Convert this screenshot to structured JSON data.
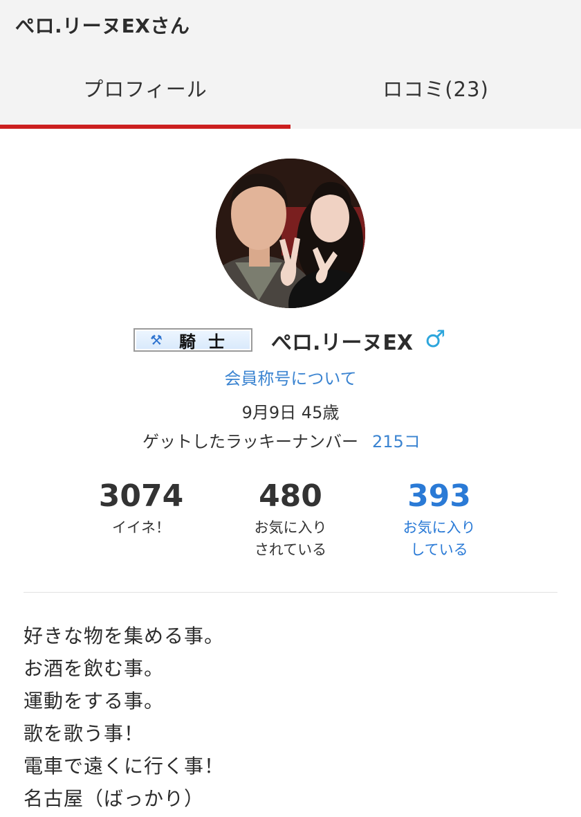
{
  "header": {
    "title": "ぺロ.リーヌEXさん"
  },
  "tabs": [
    {
      "label": "プロフィール",
      "active": true
    },
    {
      "label": "ロコミ(23)",
      "active": false
    }
  ],
  "colors": {
    "accent_red": "#cc1f1f",
    "link_blue": "#3b84d1",
    "stat_blue": "#2a7ad6",
    "gender_blue": "#2da6dc"
  },
  "profile": {
    "avatar_icon": "avatar-photo",
    "rank_badge": {
      "icon": "crossed-axes-icon",
      "icon_glyph": "⚒",
      "text": "騎士"
    },
    "username": "ぺロ.リーヌEX",
    "gender_symbol": "♂",
    "member_title_link": "会員称号について",
    "birthday_age": "9月9日 45歳",
    "lucky_label": "ゲットしたラッキーナンバー",
    "lucky_count": "215コ"
  },
  "stats": [
    {
      "value": "3074",
      "label_line1": "イイネ！",
      "label_line2": ""
    },
    {
      "value": "480",
      "label_line1": "お気に入り",
      "label_line2": "されている"
    },
    {
      "value": "393",
      "label_line1": "お気に入り",
      "label_line2": "している"
    }
  ],
  "bio": [
    "好きな物を集める事。",
    "お酒を飲む事。",
    "運動をする事。",
    "歌を歌う事！",
    "電車で遠くに行く事！",
    "名古屋（ばっかり）"
  ]
}
